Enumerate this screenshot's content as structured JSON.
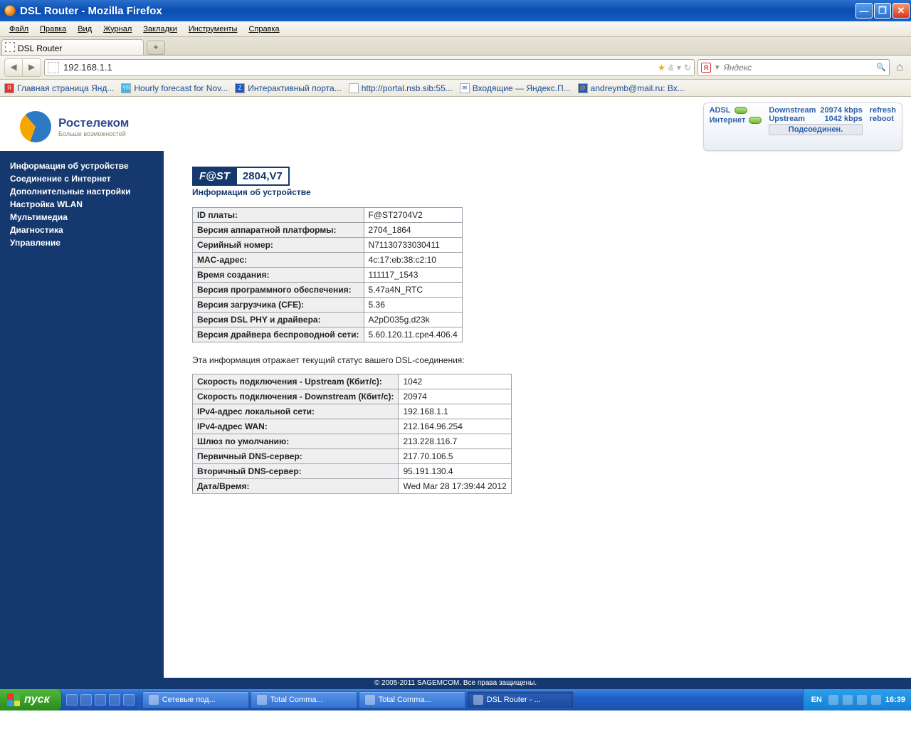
{
  "window": {
    "title": "DSL Router - Mozilla Firefox"
  },
  "menu": {
    "file": "Файл",
    "edit": "Правка",
    "view": "Вид",
    "history": "Журнал",
    "bookmarks": "Закладки",
    "tools": "Инструменты",
    "help": "Справка"
  },
  "tab": {
    "title": "DSL Router",
    "plus": "+"
  },
  "nav": {
    "url": "192.168.1.1",
    "search_placeholder": "Яндекс"
  },
  "bookmarks": {
    "b1": "Главная страница Янд...",
    "b2": "Hourly forecast for Nov...",
    "b3": "Интерактивный порта...",
    "b4": "http://portal.nsb.sib:55...",
    "b5": "Входящие — Яндекс.П...",
    "b6": "andreymb@mail.ru: Вх..."
  },
  "logo": {
    "name": "Ростелеком",
    "tag": "Больше возможностей"
  },
  "status": {
    "adsl": "ADSL",
    "internet": "Интернет",
    "down_l": "Downstream",
    "down_v": "20974 kbps",
    "up_l": "Upstream",
    "up_v": "1042 kbps",
    "refresh": "refresh",
    "reboot": "reboot",
    "connected": "Подсоединен."
  },
  "sidebar": {
    "i1": "Информация об устройстве",
    "i2": "Соединение с Интернет",
    "i3": "Дополнительные настройки",
    "i4": "Настройка WLAN",
    "i5": "Мультимедиа",
    "i6": "Диагностика",
    "i7": "Управление"
  },
  "model": {
    "a": "F@ST",
    "b": "2804,V7"
  },
  "subheading": "Информация об устройстве",
  "table1": {
    "r1l": "ID платы:",
    "r1v": "F@ST2704V2",
    "r2l": "Версия аппаратной платформы:",
    "r2v": "2704_1864",
    "r3l": "Серийный номер:",
    "r3v": "N71130733030411",
    "r4l": "MAC-адрес:",
    "r4v": "4c:17:eb:38:c2:10",
    "r5l": "Время создания:",
    "r5v": "111117_1543",
    "r6l": "Версия программного обеспечения:",
    "r6v": "5.47a4N_RTC",
    "r7l": "Версия загрузчика (CFE):",
    "r7v": "5.36",
    "r8l": "Версия DSL PHY и драйвера:",
    "r8v": "A2pD035g.d23k",
    "r9l": "Версия драйвера беспроводной сети:",
    "r9v": "5.60.120.11.cpe4.406.4"
  },
  "note": "Эта информация отражает текущий статус вашего DSL-соединения:",
  "table2": {
    "r1l": "Скорость подключения - Upstream (Кбит/с):",
    "r1v": "1042",
    "r2l": "Скорость подключения - Downstream (Кбит/с):",
    "r2v": "20974",
    "r3l": "IPv4-адрес локальной сети:",
    "r3v": "192.168.1.1",
    "r4l": "IPv4-адрес WAN:",
    "r4v": "212.164.96.254",
    "r5l": "Шлюз по умолчанию:",
    "r5v": "213.228.116.7",
    "r6l": "Первичный DNS-сервер:",
    "r6v": "217.70.106.5",
    "r7l": "Вторичный DNS-сервер:",
    "r7v": "95.191.130.4",
    "r8l": "Дата/Время:",
    "r8v": "Wed Mar 28 17:39:44 2012"
  },
  "footer": "© 2005-2011 SAGEMCOM. Все права защищены.",
  "taskbar": {
    "start": "пуск",
    "t1": "Сетевые под...",
    "t2": "Total Comma...",
    "t3": "Total Comma...",
    "t4": "DSL Router - ...",
    "lang": "EN",
    "clock": "16:39"
  }
}
